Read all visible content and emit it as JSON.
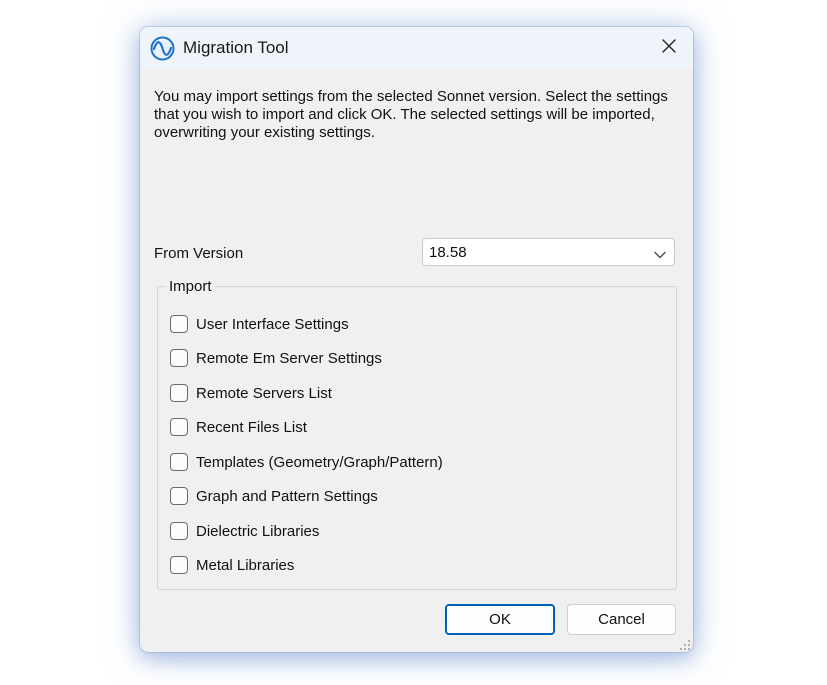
{
  "window": {
    "title": "Migration Tool",
    "app_icon": "sine-wave-icon",
    "close_icon": "close-icon"
  },
  "intro_text": "You may import settings from the selected Sonnet version. Select the settings that you wish to import and click OK. The selected settings will be imported, overwriting your existing settings.",
  "from_version": {
    "label": "From Version",
    "selected": "18.58"
  },
  "import_group": {
    "legend": "Import",
    "options": [
      {
        "label": "User Interface Settings",
        "checked": false
      },
      {
        "label": "Remote Em Server Settings",
        "checked": false
      },
      {
        "label": "Remote Servers List",
        "checked": false
      },
      {
        "label": "Recent Files List",
        "checked": false
      },
      {
        "label": "Templates (Geometry/Graph/Pattern)",
        "checked": false
      },
      {
        "label": "Graph and Pattern Settings",
        "checked": false
      },
      {
        "label": "Dielectric Libraries",
        "checked": false
      },
      {
        "label": "Metal Libraries",
        "checked": false
      }
    ]
  },
  "buttons": {
    "ok": "OK",
    "cancel": "Cancel"
  },
  "colors": {
    "accent": "#005fb8",
    "icon_blue": "#1f6fc5"
  }
}
